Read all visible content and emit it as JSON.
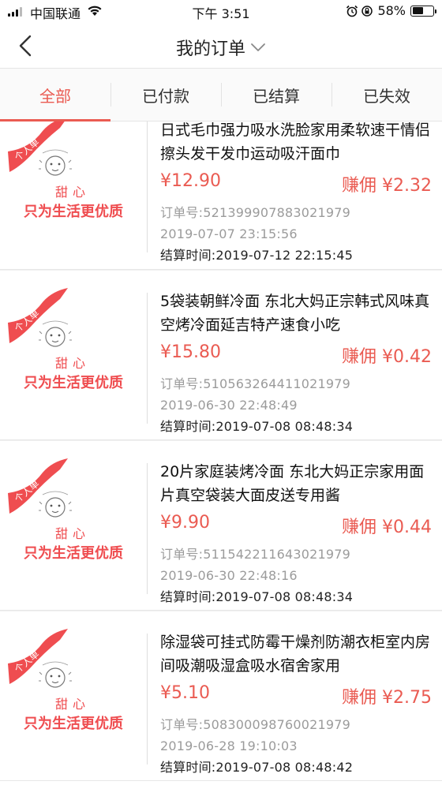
{
  "status_bar": {
    "carrier": "中国联通",
    "time": "下午 3:51",
    "battery_percent": "58%",
    "battery_level": 0.58,
    "icons": [
      "signal-icon",
      "wifi-icon",
      "alarm-icon",
      "orientation-lock-icon",
      "battery-icon"
    ]
  },
  "nav": {
    "back_icon": "chevron-left-icon",
    "title": "我的订单",
    "title_icon": "chevron-down-icon"
  },
  "tabs": [
    {
      "label": "全部",
      "active": true
    },
    {
      "label": "已付款",
      "active": false
    },
    {
      "label": "已结算",
      "active": false
    },
    {
      "label": "已失效",
      "active": false
    }
  ],
  "colors": {
    "accent": "#ea5b52",
    "thumb_red": "#ef4d50",
    "meta_gray": "#9b9b9b"
  },
  "thumbnail": {
    "tian": "甜心",
    "slogan": "只为生活更优质"
  },
  "order_labels": {
    "order_no": "订单号:",
    "settle_time": "结算时间:",
    "commission": "赚佣"
  },
  "orders": [
    {
      "title": "日式毛巾强力吸水洗脸家用柔软速干情侣擦头发干发巾运动吸汗面巾",
      "price": "¥12.90",
      "commission": "赚佣 ¥2.32",
      "order_no": "订单号:521399907883021979",
      "created": "2019-07-07 23:15:56",
      "settle_time": "结算时间:2019-07-12 22:15:45"
    },
    {
      "title": "5袋装朝鲜冷面 东北大妈正宗韩式风味真空烤冷面延吉特产速食小吃",
      "price": "¥15.80",
      "commission": "赚佣 ¥0.42",
      "order_no": "订单号:510563264411021979",
      "created": "2019-06-30 22:48:49",
      "settle_time": "结算时间:2019-07-08 08:48:34"
    },
    {
      "title": "20片家庭装烤冷面 东北大妈正宗家用面片真空袋装大面皮送专用酱",
      "price": "¥9.90",
      "commission": "赚佣 ¥0.44",
      "order_no": "订单号:511542211643021979",
      "created": "2019-06-30 22:48:16",
      "settle_time": "结算时间:2019-07-08 08:48:34"
    },
    {
      "title": "除湿袋可挂式防霉干燥剂防潮衣柜室内房间吸潮吸湿盒吸水宿舍家用",
      "price": "¥5.10",
      "commission": "赚佣 ¥2.75",
      "order_no": "订单号:508300098760021979",
      "created": "2019-06-28 19:10:03",
      "settle_time": "结算时间:2019-07-08 08:48:42"
    }
  ]
}
